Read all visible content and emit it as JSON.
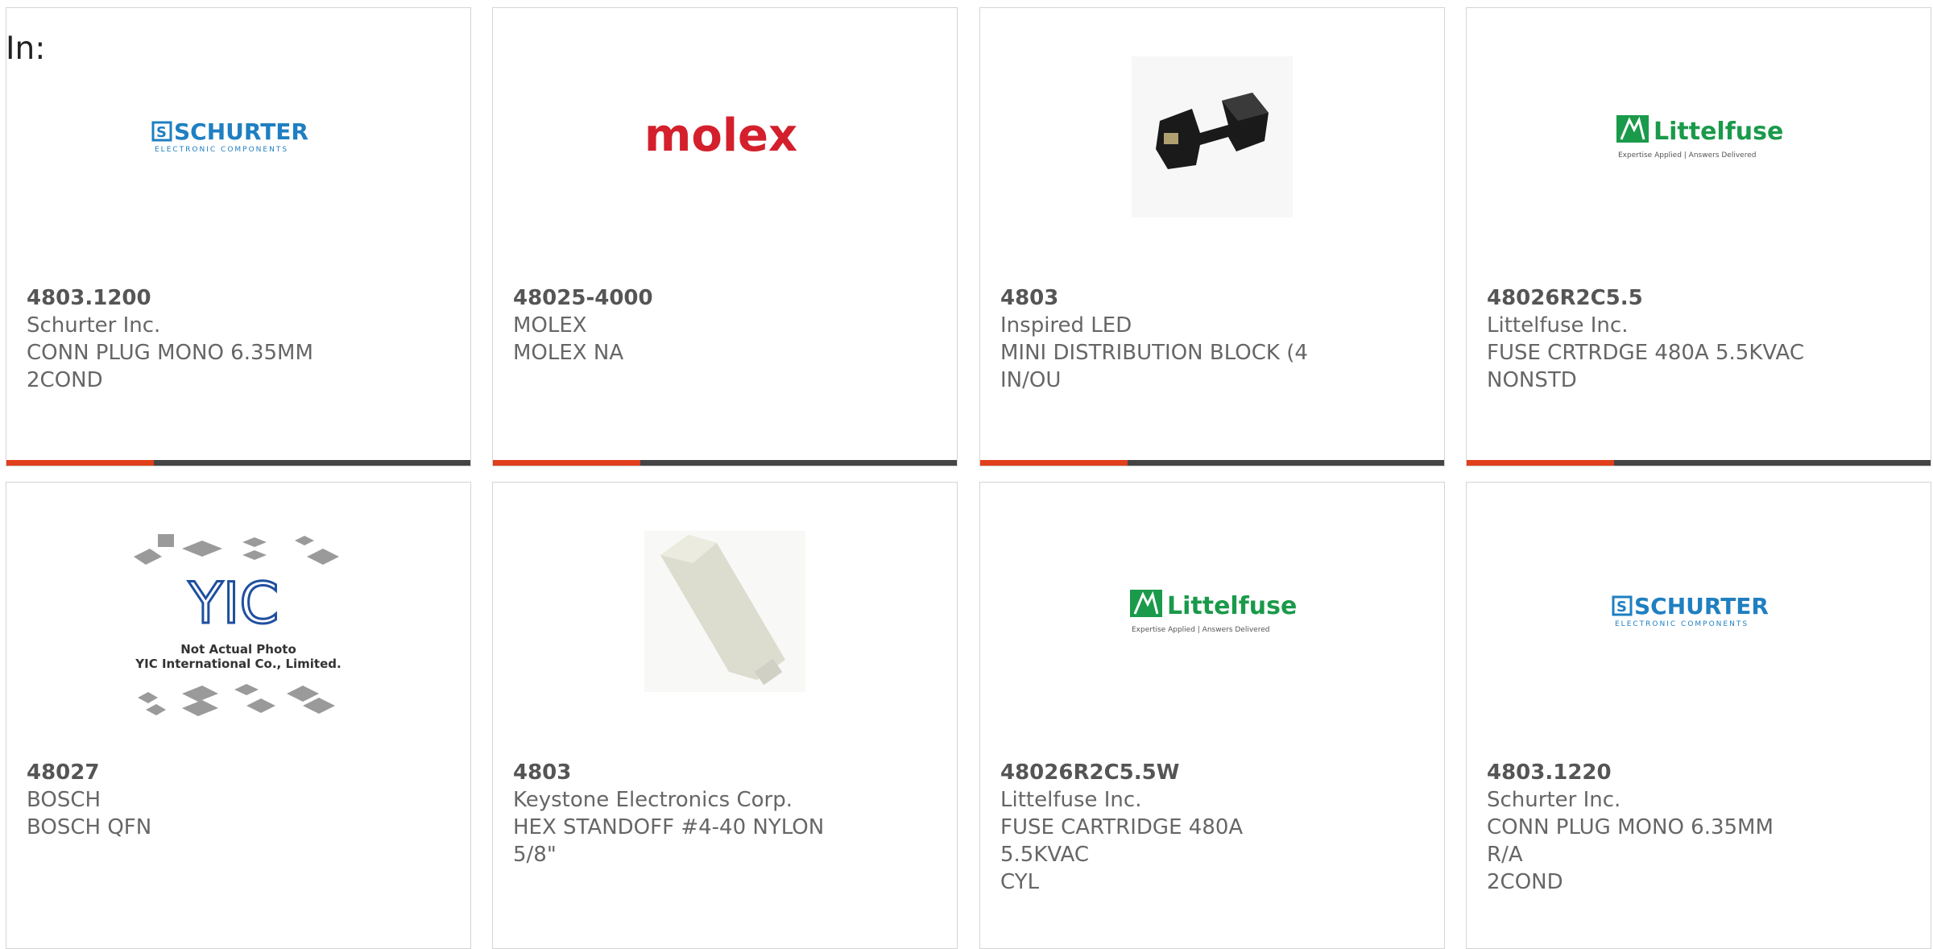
{
  "filter_label": "In:",
  "cards": [
    {
      "part": "4803.1200",
      "manufacturer": "Schurter Inc.",
      "desc1": "CONN PLUG MONO 6.35MM",
      "desc2": "2COND",
      "image": "schurter-logo"
    },
    {
      "part": "48025-4000",
      "manufacturer": "MOLEX",
      "desc1": "MOLEX NA",
      "desc2": "",
      "image": "molex-logo"
    },
    {
      "part": "4803",
      "manufacturer": "Inspired LED",
      "desc1": "MINI DISTRIBUTION BLOCK (4",
      "desc2": "IN/OU",
      "image": "distribution-block-photo"
    },
    {
      "part": "48026R2C5.5",
      "manufacturer": "Littelfuse Inc.",
      "desc1": "FUSE CRTRDGE 480A 5.5KVAC",
      "desc2": "NONSTD",
      "image": "littelfuse-logo"
    },
    {
      "part": "48027",
      "manufacturer": "BOSCH",
      "desc1": "BOSCH QFN",
      "desc2": "",
      "image": "yic-placeholder"
    },
    {
      "part": "4803",
      "manufacturer": "Keystone Electronics Corp.",
      "desc1": "HEX STANDOFF #4-40 NYLON",
      "desc2": "5/8\"",
      "image": "hex-standoff-photo"
    },
    {
      "part": "48026R2C5.5W",
      "manufacturer": "Littelfuse Inc.",
      "desc1": "FUSE CARTRIDGE 480A 5.5KVAC",
      "desc2": "CYL",
      "image": "littelfuse-logo"
    },
    {
      "part": "4803.1220",
      "manufacturer": "Schurter Inc.",
      "desc1": "CONN PLUG MONO 6.35MM R/A",
      "desc2": "2COND",
      "image": "schurter-logo"
    }
  ],
  "logos": {
    "schurter_name": "SCHURTER",
    "schurter_tagline": "ELECTRONIC COMPONENTS",
    "molex_name": "molex",
    "littelfuse_name": "Littelfuse",
    "littelfuse_tagline": "Expertise Applied | Answers Delivered",
    "yic_mark": "YIC",
    "yic_line1": "Not Actual Photo",
    "yic_line2": "YIC International Co., Limited."
  },
  "colors": {
    "accent": "#e0401b",
    "bar": "#454545",
    "schurter_blue": "#1f7fc1",
    "molex_red": "#d4202c",
    "littelfuse_green": "#1a9a4a"
  }
}
